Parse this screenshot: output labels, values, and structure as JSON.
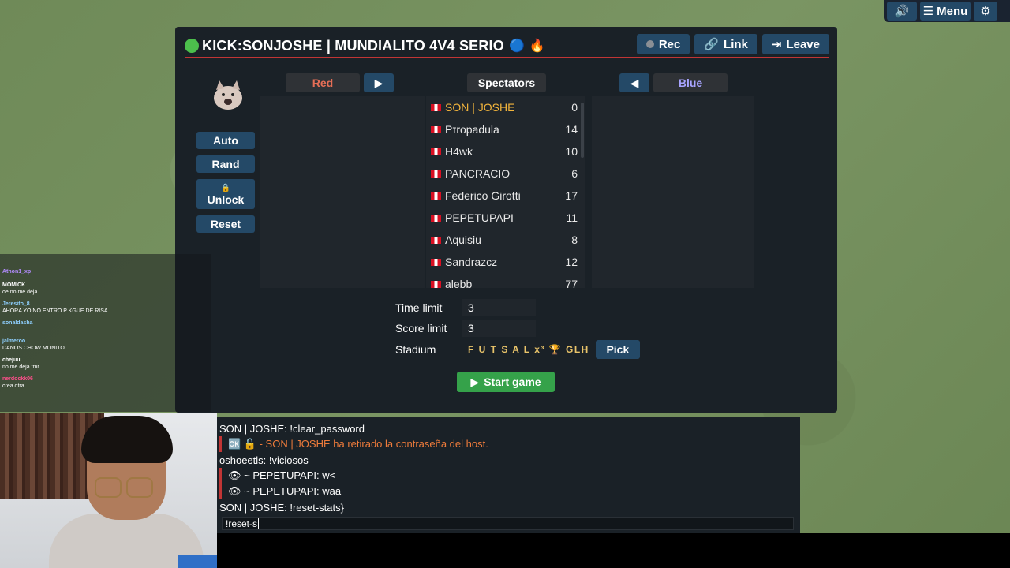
{
  "top_controls": {
    "volume_icon": "speaker-icon",
    "menu_label": "Menu",
    "settings_icon": "gear-icon"
  },
  "room": {
    "title": "KICK:SONJOSHE | MUNDIALITO 4V4 SERIO",
    "title_emojis": [
      "🔵",
      "🔥"
    ],
    "buttons": {
      "rec": "Rec",
      "link": "Link",
      "leave": "Leave"
    },
    "side_buttons": {
      "auto": "Auto",
      "rand": "Rand",
      "unlock": "Unlock",
      "reset": "Reset"
    },
    "tabs": {
      "red": "Red",
      "spectators": "Spectators",
      "blue": "Blue"
    },
    "spectators": [
      {
        "name": "SON | JOSHE",
        "value": "0",
        "host": true
      },
      {
        "name": "Pɪropadula",
        "value": "14"
      },
      {
        "name": "H4wk",
        "value": "10"
      },
      {
        "name": "PANCRACIO",
        "value": "6"
      },
      {
        "name": "Federico Girotti",
        "value": "17"
      },
      {
        "name": "PEPETUPAPI",
        "value": "11"
      },
      {
        "name": "Aquisiu",
        "value": "8"
      },
      {
        "name": "Sandrazcz",
        "value": "12"
      },
      {
        "name": "alebb",
        "value": "77"
      }
    ],
    "settings": {
      "time_limit_label": "Time limit",
      "time_limit": "3",
      "score_limit_label": "Score limit",
      "score_limit": "3",
      "stadium_label": "Stadium",
      "stadium": "F U T S A L x³ 🏆 GLH",
      "pick": "Pick"
    },
    "start_game": "Start game",
    "colors": {
      "accent": "#244967",
      "start": "#35a24a",
      "red_team": "#e56e56",
      "blue_team": "#a8a4ff",
      "host": "#f2b43c"
    }
  },
  "chat": {
    "lines": [
      {
        "text": "SON | JOSHE: !clear_password",
        "type": "normal"
      },
      {
        "text": "🆗 🔓 - SON | JOSHE ha retirado la contraseña del host.",
        "type": "sys-orange"
      },
      {
        "text": "oshoeetls: !viciosos",
        "type": "normal"
      },
      {
        "text": "👁 ~ PEPETUPAPI: w<",
        "type": "sys"
      },
      {
        "text": "👁 ~ PEPETUPAPI: waa",
        "type": "sys"
      },
      {
        "text": "SON | JOSHE: !reset-stats}",
        "type": "normal"
      }
    ],
    "input_value": "!reset-s"
  },
  "stream_chat": [
    {
      "user": "Athon1_xp",
      "msg": "",
      "style": "purple"
    },
    {
      "user": "MOMICK",
      "msg": "oe no me deja",
      "style": "white"
    },
    {
      "user": "Jeresito_8",
      "msg": "AHORA YO NO ENTRO P KGUE DE RISA",
      "style": ""
    },
    {
      "user": "sonaldasha",
      "msg": "",
      "style": ""
    },
    {
      "user": "jalmeroo",
      "msg": "DANOS CHOW MONITO",
      "style": ""
    },
    {
      "user": "chejuu",
      "msg": "no me deja tmr",
      "style": "white"
    },
    {
      "user": "nerdockk06",
      "msg": "crea otra",
      "style": "pink"
    }
  ]
}
